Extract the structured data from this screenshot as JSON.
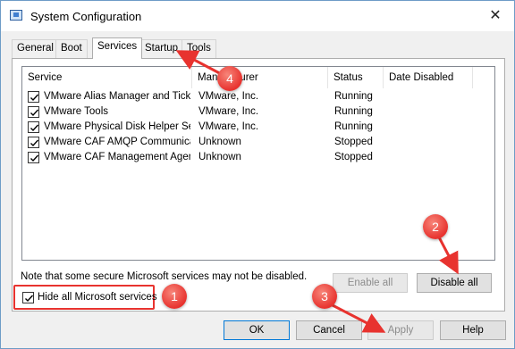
{
  "window": {
    "title": "System Configuration",
    "close_glyph": "✕"
  },
  "tabs": [
    {
      "label": "General"
    },
    {
      "label": "Boot"
    },
    {
      "label": "Services"
    },
    {
      "label": "Startup"
    },
    {
      "label": "Tools"
    }
  ],
  "active_tab": "Services",
  "services_table": {
    "columns": [
      "Service",
      "Manufacturer",
      "Status",
      "Date Disabled"
    ],
    "rows": [
      {
        "checked": true,
        "service": "VMware Alias Manager and Ticke...",
        "manufacturer": "VMware, Inc.",
        "status": "Running",
        "date_disabled": ""
      },
      {
        "checked": true,
        "service": "VMware Tools",
        "manufacturer": "VMware, Inc.",
        "status": "Running",
        "date_disabled": ""
      },
      {
        "checked": true,
        "service": "VMware Physical Disk Helper Ser...",
        "manufacturer": "VMware, Inc.",
        "status": "Running",
        "date_disabled": ""
      },
      {
        "checked": true,
        "service": "VMware CAF AMQP Communicati...",
        "manufacturer": "Unknown",
        "status": "Stopped",
        "date_disabled": ""
      },
      {
        "checked": true,
        "service": "VMware CAF Management Agen...",
        "manufacturer": "Unknown",
        "status": "Stopped",
        "date_disabled": ""
      }
    ]
  },
  "note": "Note that some secure Microsoft services may not be disabled.",
  "buttons": {
    "enable_all": "Enable all",
    "disable_all": "Disable all",
    "ok": "OK",
    "cancel": "Cancel",
    "apply": "Apply",
    "help": "Help"
  },
  "hide_microsoft": {
    "label": "Hide all Microsoft services",
    "checked": true
  },
  "annotations": {
    "color": "#e8332f",
    "badges": [
      "1",
      "2",
      "3",
      "4"
    ]
  }
}
